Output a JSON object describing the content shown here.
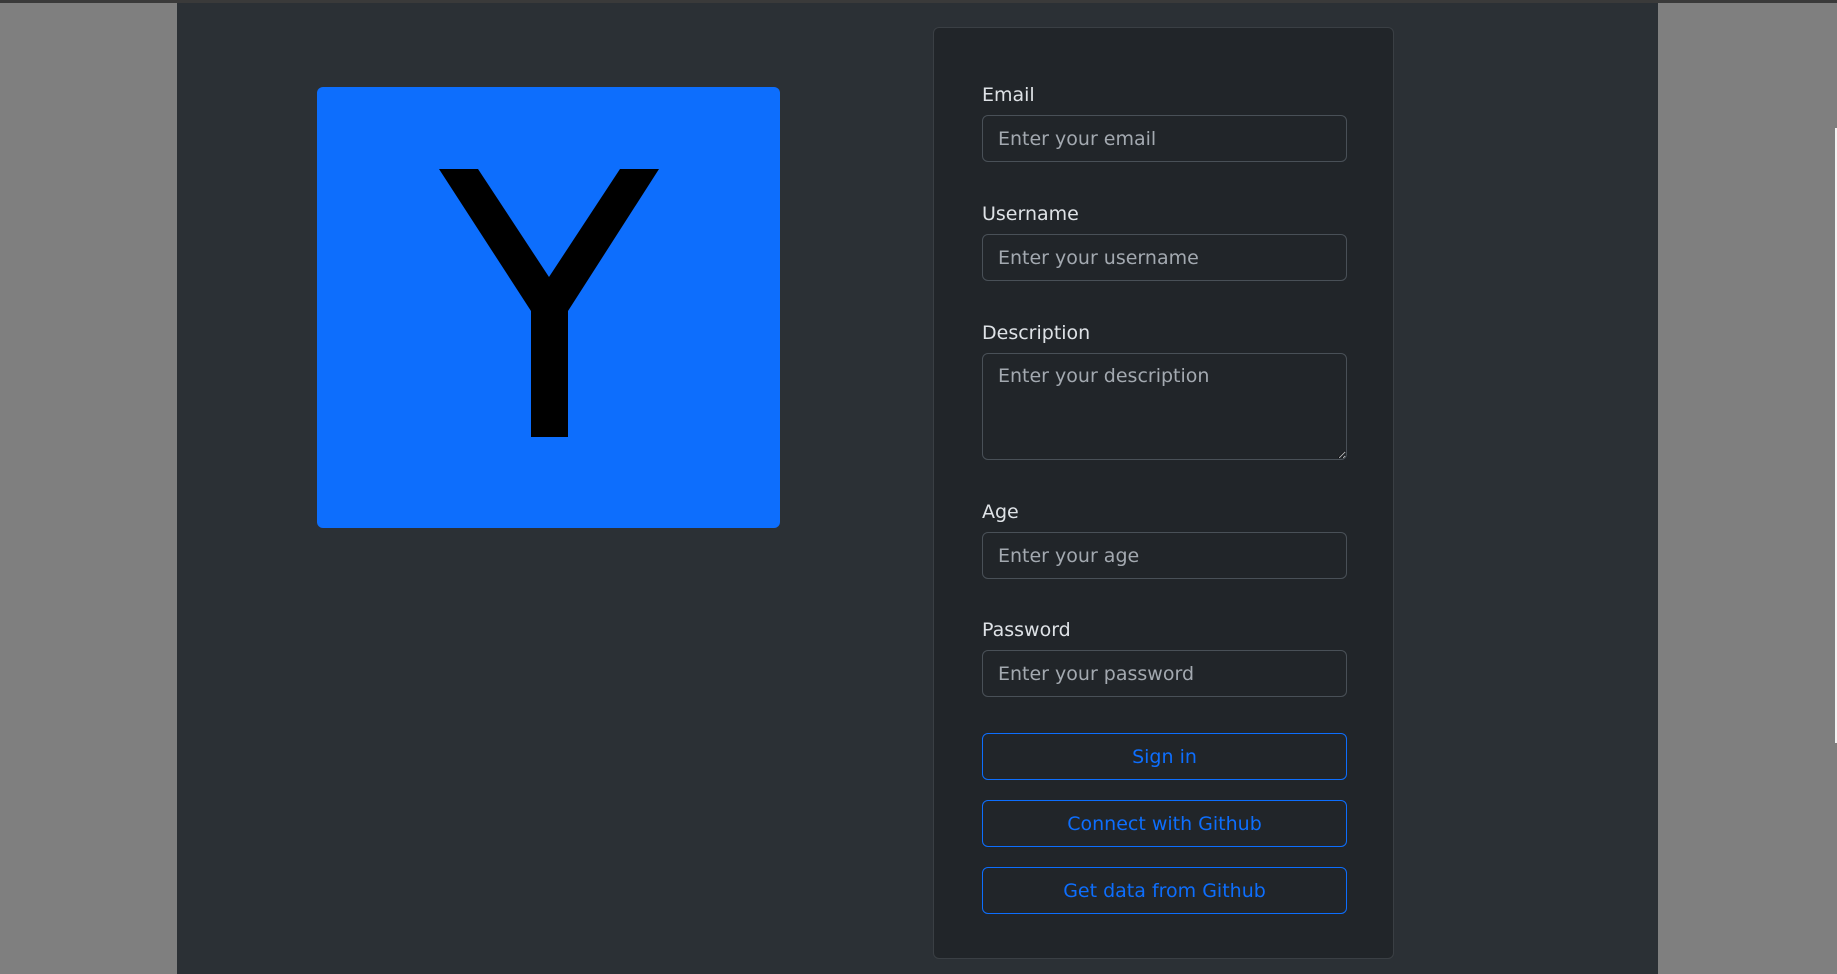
{
  "logo": {
    "letter": "Y",
    "background_color": "#0d6efd",
    "letter_color": "#000000"
  },
  "form": {
    "email": {
      "label": "Email",
      "placeholder": "Enter your email"
    },
    "username": {
      "label": "Username",
      "placeholder": "Enter your username"
    },
    "description": {
      "label": "Description",
      "placeholder": "Enter your description"
    },
    "age": {
      "label": "Age",
      "placeholder": "Enter your age"
    },
    "password": {
      "label": "Password",
      "placeholder": "Enter your password"
    },
    "buttons": {
      "sign_in": "Sign in",
      "connect_github": "Connect with Github",
      "get_github_data": "Get data from Github"
    }
  },
  "colors": {
    "page_background": "#2b3035",
    "card_background": "#212529",
    "accent": "#0d6efd",
    "outer_background": "#7f7f7f"
  }
}
